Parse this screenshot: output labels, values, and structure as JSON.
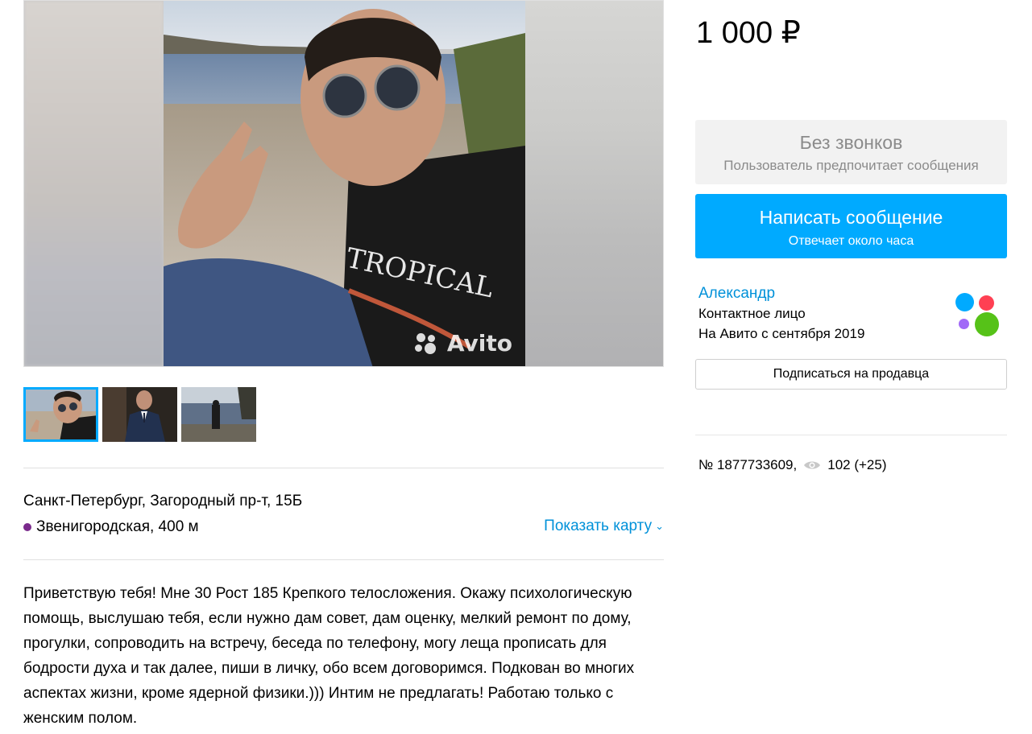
{
  "gallery": {
    "watermark": "Avito",
    "thumbnails": [
      "photo-1",
      "photo-2",
      "photo-3"
    ],
    "active_thumbnail": 0
  },
  "location": {
    "address": "Санкт-Петербург, Загородный пр-т, 15Б",
    "metro": "Звенигородская, 400 м",
    "metro_color": "#7a2a8c",
    "map_link": "Показать карту"
  },
  "description": "Приветствую тебя! Мне 30 Рост 185 Крепкого телосложения. Окажу психологическую помощь, выслушаю тебя, если нужно дам совет, дам оценку, мелкий ремонт по дому, прогулки, сопроводить на встречу, беседа по телефону, могу леща прописать для бодрости духа и так далее, пиши в личку, обо всем договоримся. Подкован во многих аспектах жизни, кроме ядерной физики.))) Интим не предлагать! Работаю только с женским полом.",
  "sidebar": {
    "price": "1 000 ₽",
    "no_calls_title": "Без звонков",
    "no_calls_subtitle": "Пользователь предпочитает сообщения",
    "message_button": "Написать сообщение",
    "message_subtitle": "Отвечает около часа",
    "accent_color": "#00aaff",
    "seller_name": "Александр",
    "seller_role": "Контактное лицо",
    "seller_since": "На Авито с сентября 2019",
    "subscribe_button": "Подписаться на продавца",
    "listing_number": "№ 1877733609,",
    "views": "102 (+25)"
  }
}
